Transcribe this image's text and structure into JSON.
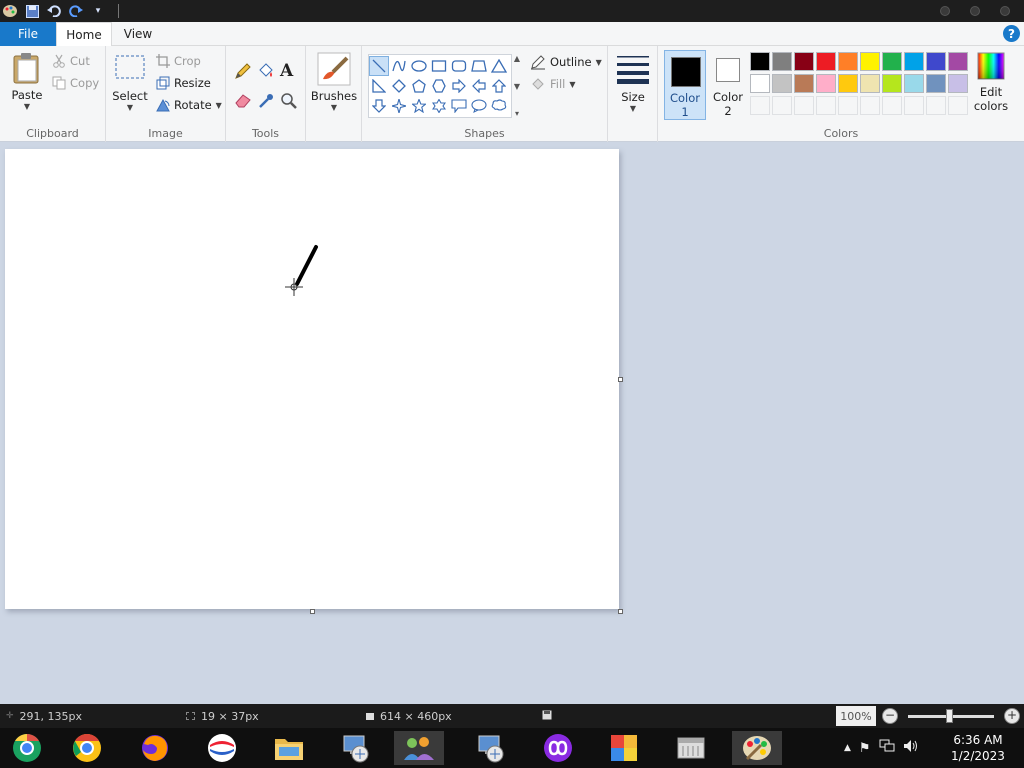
{
  "tabs": {
    "file": "File",
    "home": "Home",
    "view": "View",
    "help": "?"
  },
  "clipboard": {
    "label": "Clipboard",
    "paste": "Paste",
    "cut": "Cut",
    "copy": "Copy"
  },
  "image": {
    "label": "Image",
    "select": "Select",
    "crop": "Crop",
    "resize": "Resize",
    "rotate": "Rotate"
  },
  "tools": {
    "label": "Tools"
  },
  "brushes": {
    "label": "Brushes"
  },
  "shapes": {
    "label": "Shapes",
    "outline": "Outline",
    "fill": "Fill"
  },
  "size": {
    "label": "Size"
  },
  "colors": {
    "label": "Colors",
    "color1": "Color",
    "color1_num": "1",
    "color2": "Color",
    "color2_num": "2",
    "edit": "Edit",
    "edit2": "colors",
    "color1_value": "#000000",
    "color2_value": "#ffffff",
    "row1": [
      "#000000",
      "#7f7f7f",
      "#880015",
      "#ed1c24",
      "#ff7f27",
      "#fff200",
      "#22b14c",
      "#00a2e8",
      "#3f48cc",
      "#a349a4"
    ],
    "row2": [
      "#ffffff",
      "#c3c3c3",
      "#b97a57",
      "#ffaec9",
      "#ffc90e",
      "#efe4b0",
      "#b5e61d",
      "#99d9ea",
      "#7092be",
      "#c8bfe7"
    ]
  },
  "status": {
    "cursor_pos": "291, 135px",
    "selection_size": "19 × 37px",
    "canvas_size": "614 × 460px",
    "zoom": "100%"
  },
  "clock": {
    "time": "6:36 AM",
    "date": "1/2/2023"
  }
}
